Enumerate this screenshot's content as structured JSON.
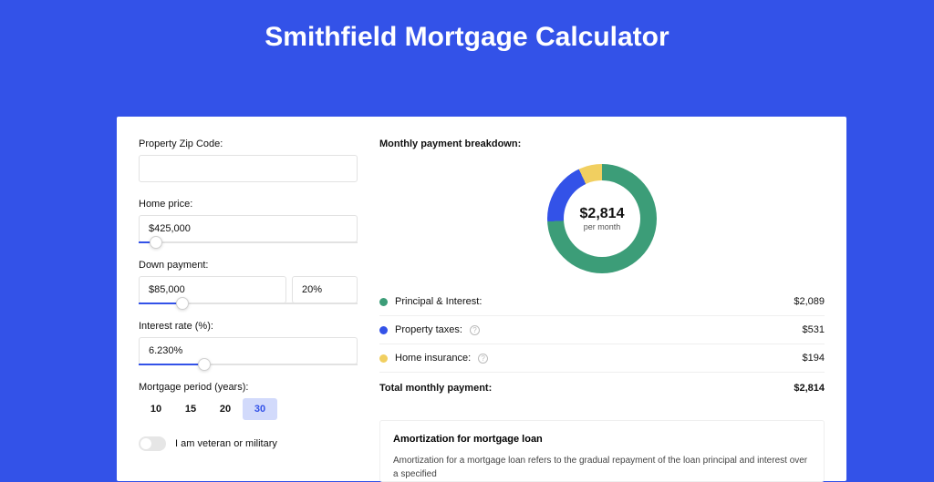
{
  "title": "Smithfield Mortgage Calculator",
  "inputs": {
    "zip": {
      "label": "Property Zip Code:",
      "value": ""
    },
    "price": {
      "label": "Home price:",
      "value": "$425,000",
      "slider_pct": 8
    },
    "down": {
      "label": "Down payment:",
      "amount": "$85,000",
      "percent": "20%",
      "slider_pct": 20
    },
    "rate": {
      "label": "Interest rate (%):",
      "value": "6.230%",
      "slider_pct": 30
    },
    "period": {
      "label": "Mortgage period (years):",
      "options": [
        "10",
        "15",
        "20",
        "30"
      ],
      "selected": "30"
    },
    "veteran": {
      "label": "I am veteran or military",
      "on": false
    }
  },
  "breakdown": {
    "section_title": "Monthly payment breakdown:",
    "total_value": "$2,814",
    "total_sub": "per month",
    "items": [
      {
        "label": "Principal & Interest:",
        "value": "$2,089",
        "color": "#3c9d78",
        "info": false
      },
      {
        "label": "Property taxes:",
        "value": "$531",
        "color": "#3352e8",
        "info": true
      },
      {
        "label": "Home insurance:",
        "value": "$194",
        "color": "#f1cf60",
        "info": true
      }
    ],
    "total_label": "Total monthly payment:",
    "total_row_value": "$2,814"
  },
  "amort": {
    "title": "Amortization for mortgage loan",
    "text": "Amortization for a mortgage loan refers to the gradual repayment of the loan principal and interest over a specified"
  },
  "chart_data": {
    "type": "pie",
    "title": "Monthly payment breakdown",
    "series": [
      {
        "name": "Principal & Interest",
        "value": 2089,
        "color": "#3c9d78"
      },
      {
        "name": "Property taxes",
        "value": 531,
        "color": "#3352e8"
      },
      {
        "name": "Home insurance",
        "value": 194,
        "color": "#f1cf60"
      }
    ],
    "total": 2814,
    "center_label": "$2,814 per month"
  }
}
